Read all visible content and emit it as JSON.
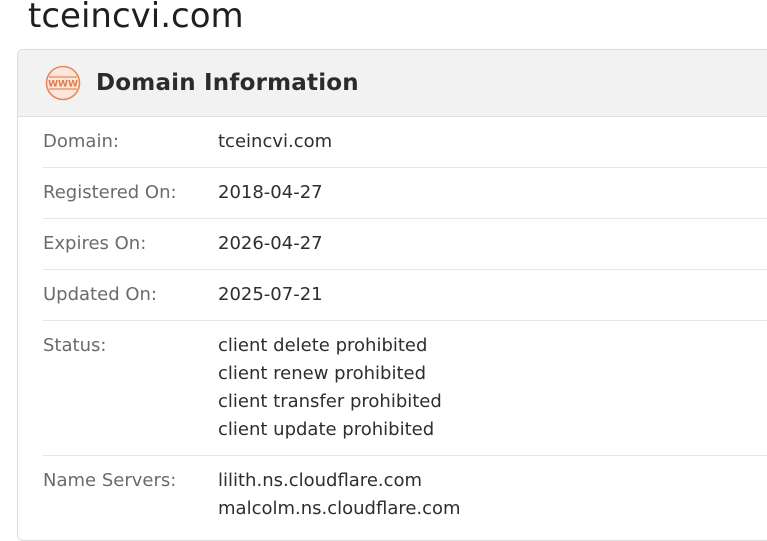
{
  "page": {
    "title": "tceincvi.com"
  },
  "card": {
    "icon": "www-globe-icon",
    "title": "Domain Information",
    "accent_color": "#e8885a"
  },
  "rows": [
    {
      "label": "Domain:",
      "values": [
        "tceincvi.com"
      ]
    },
    {
      "label": "Registered On:",
      "values": [
        "2018-04-27"
      ]
    },
    {
      "label": "Expires On:",
      "values": [
        "2026-04-27"
      ]
    },
    {
      "label": "Updated On:",
      "values": [
        "2025-07-21"
      ]
    },
    {
      "label": "Status:",
      "values": [
        "client delete prohibited",
        "client renew prohibited",
        "client transfer prohibited",
        "client update prohibited"
      ]
    },
    {
      "label": "Name Servers:",
      "values": [
        "lilith.ns.cloudflare.com",
        "malcolm.ns.cloudflare.com"
      ]
    }
  ]
}
